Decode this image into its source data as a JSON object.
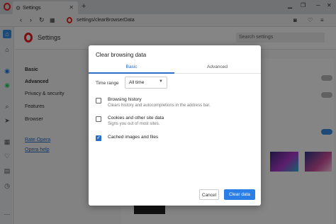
{
  "browser": {
    "tab": {
      "title": "Settings"
    },
    "url": "settings/clearBrowserData"
  },
  "settings_page": {
    "title": "Settings",
    "search_placeholder": "Search settings",
    "nav": [
      {
        "label": "Basic"
      },
      {
        "label": "Advanced"
      },
      {
        "label": "Privacy & security"
      },
      {
        "label": "Features"
      },
      {
        "label": "Browser"
      },
      {
        "label": "Rate Opera"
      },
      {
        "label": "Opera help"
      }
    ]
  },
  "dialog": {
    "title": "Clear browsing data",
    "tabs": [
      {
        "label": "Basic",
        "active": true
      },
      {
        "label": "Advanced",
        "active": false
      }
    ],
    "time_range": {
      "label": "Time range",
      "value": "All time"
    },
    "options": [
      {
        "title": "Browsing history",
        "description": "Clears history and autocompletions in the address bar.",
        "checked": false
      },
      {
        "title": "Cookies and other site data",
        "description": "Signs you out of most sites.",
        "checked": false
      },
      {
        "title": "Cached images and files",
        "description": "",
        "checked": true
      }
    ],
    "cancel_label": "Cancel",
    "clear_label": "Clear data"
  },
  "colors": {
    "accent": "#2a7ee6",
    "opera_red": "#ee2222"
  }
}
